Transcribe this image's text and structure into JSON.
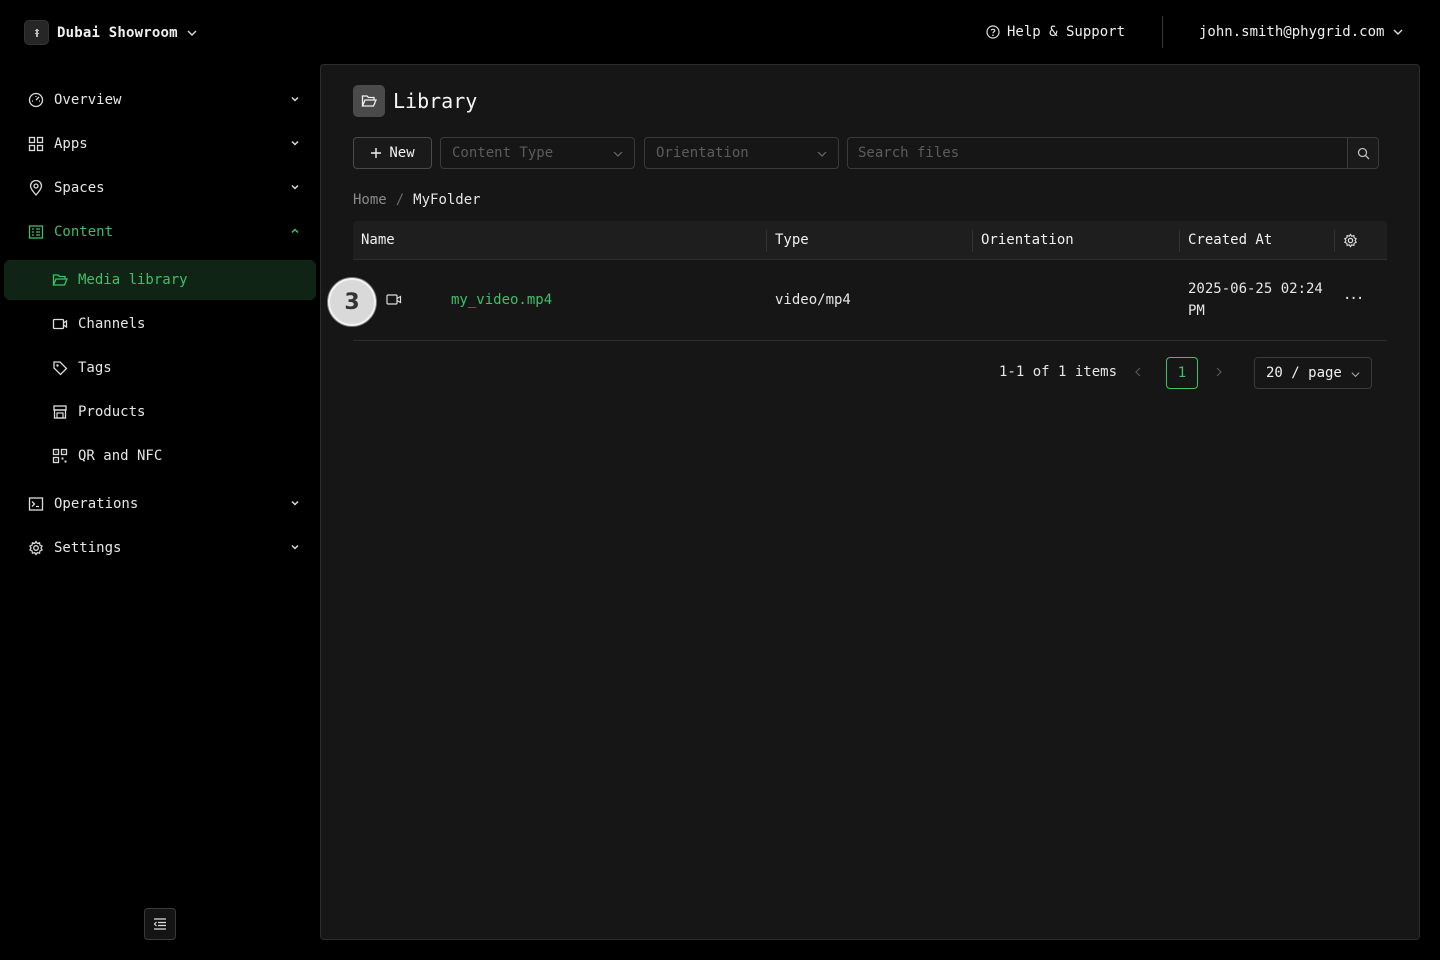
{
  "topbar": {
    "org_name": "Dubai Showroom",
    "help_label": "Help & Support",
    "user_email": "john.smith@phygrid.com"
  },
  "sidebar": {
    "items": [
      {
        "label": "Overview",
        "icon": "gauge-icon"
      },
      {
        "label": "Apps",
        "icon": "grid-icon"
      },
      {
        "label": "Spaces",
        "icon": "map-pin-icon"
      },
      {
        "label": "Content",
        "icon": "content-icon",
        "expanded": true
      },
      {
        "label": "Operations",
        "icon": "terminal-icon"
      },
      {
        "label": "Settings",
        "icon": "gear-icon"
      }
    ],
    "content_sub": [
      {
        "label": "Media library",
        "icon": "folder-open-icon",
        "selected": true
      },
      {
        "label": "Channels",
        "icon": "video-camera-icon"
      },
      {
        "label": "Tags",
        "icon": "tag-icon"
      },
      {
        "label": "Products",
        "icon": "store-icon"
      },
      {
        "label": "QR and NFC",
        "icon": "qr-code-icon"
      }
    ]
  },
  "page": {
    "title": "Library"
  },
  "toolbar": {
    "new_label": "New",
    "content_type_placeholder": "Content Type",
    "orientation_placeholder": "Orientation",
    "search_placeholder": "Search files"
  },
  "breadcrumb": {
    "home": "Home",
    "separator": "/",
    "current": "MyFolder"
  },
  "table": {
    "columns": [
      "Name",
      "Type",
      "Orientation",
      "Created At"
    ],
    "rows": [
      {
        "name": "my_video.mp4",
        "type": "video/mp4",
        "orientation": "",
        "created_at_line1": "2025-06-25 02:24",
        "created_at_line2": "PM",
        "more": "···"
      }
    ]
  },
  "annotation_badge": "3",
  "pagination": {
    "total_text": "1-1 of 1 items",
    "current_page": "1",
    "page_size": "20 / page"
  },
  "colors": {
    "accent": "#3fbf6a",
    "background": "#000000",
    "panel": "#161616",
    "selected_bg": "#0f2414"
  }
}
